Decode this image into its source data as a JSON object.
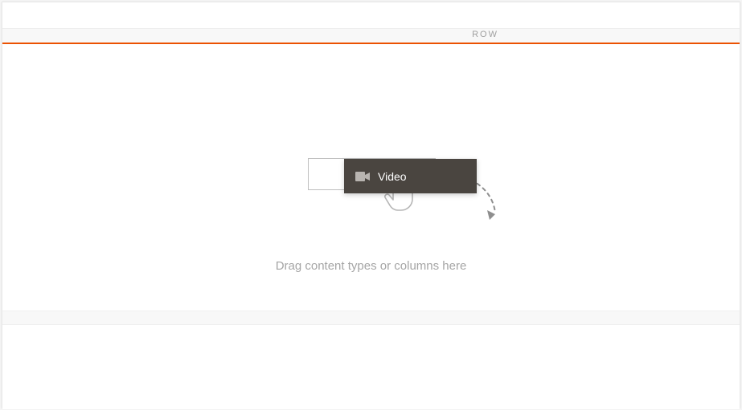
{
  "row": {
    "label": "ROW"
  },
  "drag_chip": {
    "label": "Video",
    "icon": "video-icon"
  },
  "drop_area": {
    "instructions": "Drag content types or columns here"
  },
  "colors": {
    "accent": "#eb5202",
    "chip_bg": "#4a4540"
  }
}
